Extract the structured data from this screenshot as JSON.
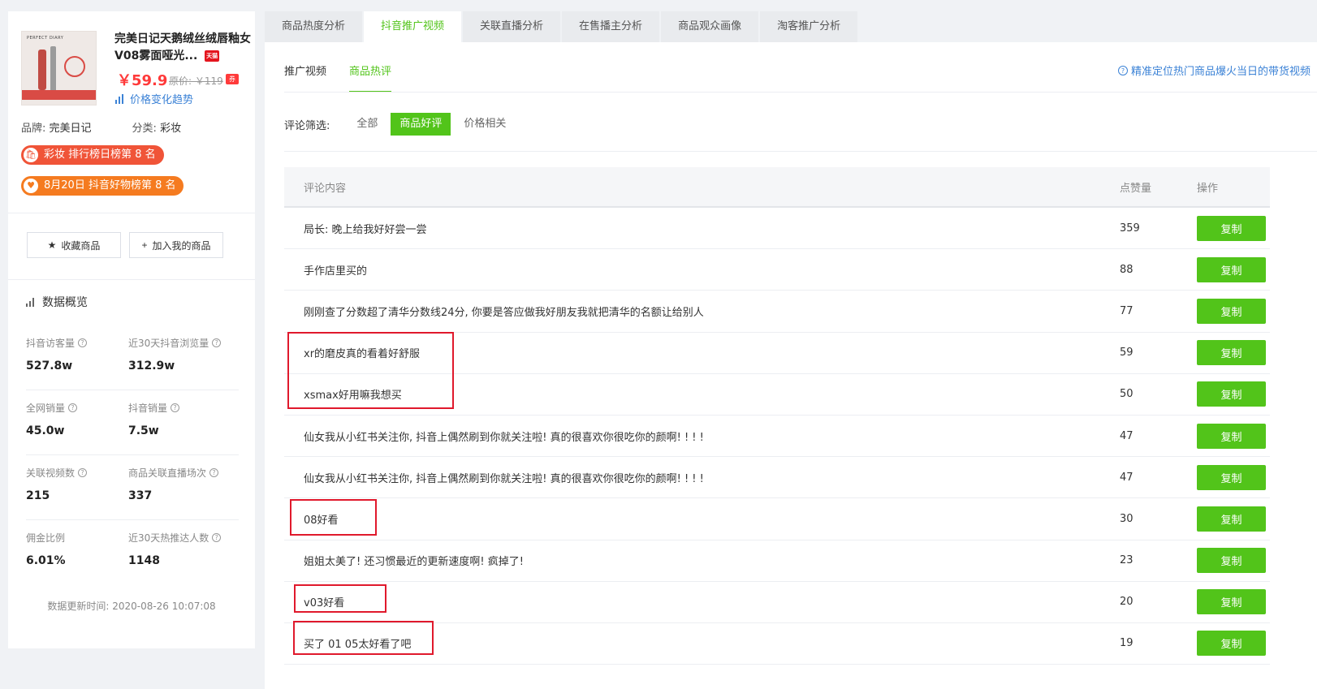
{
  "product": {
    "title": "完美日记天鹅绒丝绒唇釉女V08雾面哑光...",
    "tmall_badge": "天猫",
    "image_brand": "PERFECT DIARY",
    "price": "￥59.9",
    "original_price": "原价: ￥119",
    "coupon_badge": "券",
    "price_trend": "价格变化趋势",
    "brand_label": "品牌:",
    "brand": "完美日记",
    "category_label": "分类:",
    "category": "彩妆"
  },
  "ranks": [
    {
      "text": "彩妆 排行榜日榜第 8 名",
      "icon": "bag",
      "color": "#f05438"
    },
    {
      "text": "8月20日 抖音好物榜第 8 名",
      "icon": "heart",
      "color": "#f57b20"
    }
  ],
  "actions": {
    "favorite": "收藏商品",
    "add": "加入我的商品"
  },
  "overview": {
    "title": "数据概览",
    "stats": [
      {
        "label": "抖音访客量",
        "value": "527.8w"
      },
      {
        "label": "近30天抖音浏览量",
        "value": "312.9w"
      },
      {
        "label": "全网销量",
        "value": "45.0w"
      },
      {
        "label": "抖音销量",
        "value": "7.5w"
      },
      {
        "label": "关联视频数",
        "value": "215"
      },
      {
        "label": "商品关联直播场次",
        "value": "337"
      },
      {
        "label": "佣金比例",
        "value": "6.01%"
      },
      {
        "label": "近30天热推达人数",
        "value": "1148"
      }
    ],
    "updated": "数据更新时间: 2020-08-26 10:07:08"
  },
  "tabs": [
    "商品热度分析",
    "抖音推广视频",
    "关联直播分析",
    "在售播主分析",
    "商品观众画像",
    "淘客推广分析"
  ],
  "active_tab": 1,
  "subtabs": [
    "推广视频",
    "商品热评"
  ],
  "active_subtab": 1,
  "hint": "精准定位热门商品爆火当日的带货视频",
  "filter": {
    "label": "评论筛选:",
    "options": [
      "全部",
      "商品好评",
      "价格相关"
    ],
    "active": 1
  },
  "table": {
    "headers": [
      "评论内容",
      "点赞量",
      "操作"
    ],
    "copy_label": "复制",
    "rows": [
      {
        "comment": "局长: 晚上给我好好尝一尝",
        "likes": "359"
      },
      {
        "comment": "手作店里买的",
        "likes": "88"
      },
      {
        "comment": "刚刚查了分数超了清华分数线24分, 你要是答应做我好朋友我就把清华的名额让给别人",
        "likes": "77"
      },
      {
        "comment": "xr的磨皮真的看着好舒服",
        "likes": "59"
      },
      {
        "comment": "xsmax好用嘛我想买",
        "likes": "50"
      },
      {
        "comment": "仙女我从小红书关注你, 抖音上偶然刷到你就关注啦! 真的很喜欢你很吃你的颜啊! ! ! !",
        "likes": "47"
      },
      {
        "comment": "仙女我从小红书关注你, 抖音上偶然刷到你就关注啦! 真的很喜欢你很吃你的颜啊! ! ! !",
        "likes": "47"
      },
      {
        "comment": "08好看",
        "likes": "30"
      },
      {
        "comment": "姐姐太美了! 还习惯最近的更新速度啊! 疯掉了!",
        "likes": "23"
      },
      {
        "comment": "v03好看",
        "likes": "20"
      },
      {
        "comment": "买了 01 05太好看了吧",
        "likes": "19"
      }
    ]
  },
  "highlight_color": "#e0192c"
}
